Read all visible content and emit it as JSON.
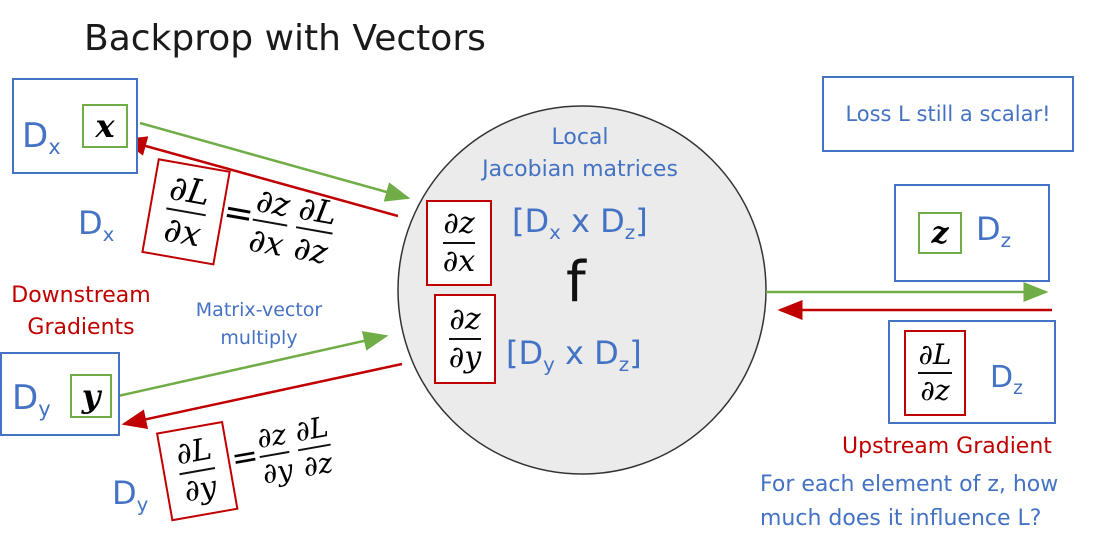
{
  "title": "Backprop with Vectors",
  "labels": {
    "dx_main": "D",
    "dx_sub": "x",
    "dy_main": "D",
    "dy_sub": "y",
    "dz_main": "D",
    "dz_sub": "z",
    "x_var": "x",
    "y_var": "y",
    "z_var": "z",
    "f": "f",
    "local_jacobian_line1": "Local",
    "local_jacobian_line2": "Jacobian matrices",
    "jac_x_open": "[D",
    "jac_x_sub1": "x",
    "jac_x_mid": " x D",
    "jac_x_sub2": "z",
    "jac_x_close": "]",
    "jac_y_open": "[D",
    "jac_y_sub1": "y",
    "jac_y_mid": " x D",
    "jac_y_sub2": "z",
    "jac_y_close": "]",
    "loss_note": "Loss L still a scalar!",
    "downstream_line1": "Downstream",
    "downstream_line2": "Gradients",
    "matvec_line1": "Matrix-vector",
    "matvec_line2": "multiply",
    "upstream": "Upstream Gradient",
    "question_line1": "For each element of z, how",
    "question_line2": "much does it influence L?"
  },
  "math": {
    "dL": "∂L",
    "dx": "∂x",
    "dy": "∂y",
    "dz": "∂z",
    "eq": "="
  },
  "colors": {
    "blue": "#4472c4",
    "green": "#70ad47",
    "red": "#c00000",
    "circle_fill": "#ebebeb"
  }
}
